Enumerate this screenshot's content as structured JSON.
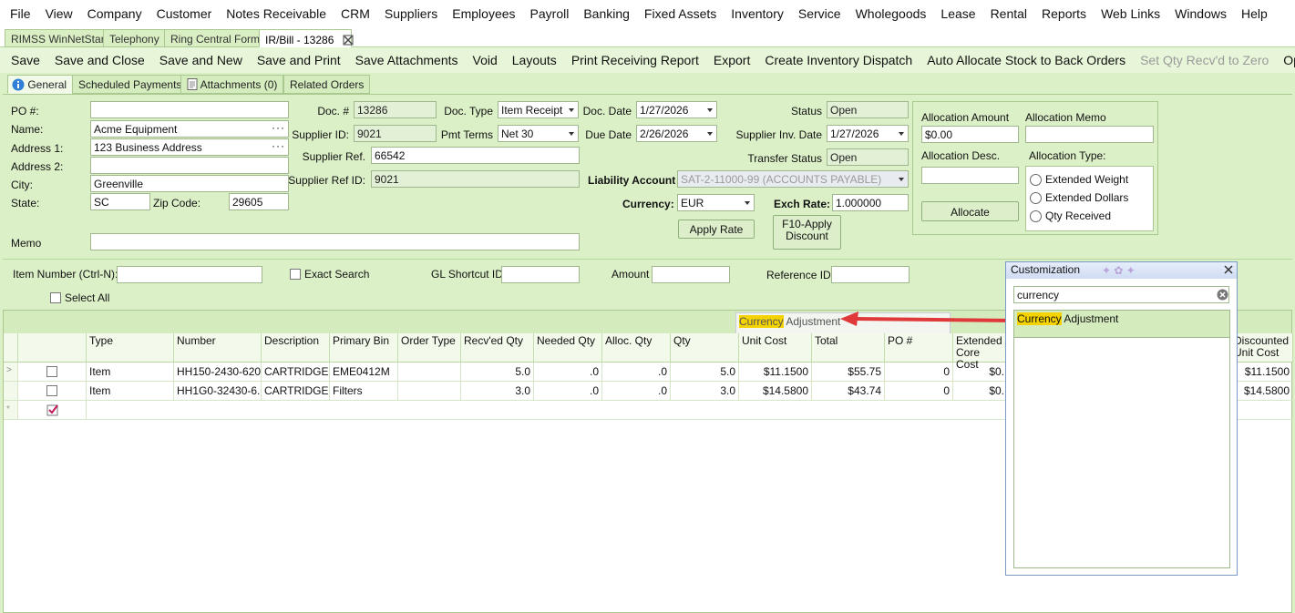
{
  "menu": [
    "File",
    "View",
    "Company",
    "Customer",
    "Notes Receivable",
    "CRM",
    "Suppliers",
    "Employees",
    "Payroll",
    "Banking",
    "Fixed Assets",
    "Inventory",
    "Service",
    "Wholegoods",
    "Lease",
    "Rental",
    "Reports",
    "Web Links",
    "Windows",
    "Help"
  ],
  "window_tabs": [
    "RIMSS WinNetStar",
    "Telephony",
    "Ring Central Form",
    "IR/Bill - 13286"
  ],
  "toolbar": [
    "Save",
    "Save and Close",
    "Save and New",
    "Save and Print",
    "Save Attachments",
    "Void",
    "Layouts",
    "Print Receiving Report",
    "Export",
    "Create Inventory Dispatch",
    "Auto Allocate Stock to Back Orders",
    "Set Qty Recv'd to Zero",
    "Options"
  ],
  "form_tabs": [
    "General",
    "Scheduled Payments",
    "Attachments (0)",
    "Related Orders"
  ],
  "form": {
    "po_label": "PO #:",
    "po": "",
    "name_label": "Name:",
    "name": "Acme Equipment",
    "address1_label": "Address 1:",
    "address1": "123 Business Address",
    "address2_label": "Address 2:",
    "address2": "",
    "city_label": "City:",
    "city": "Greenville",
    "state_label": "State:",
    "state": "SC",
    "zip_label": "Zip Code:",
    "zip": "29605",
    "memo_label": "Memo",
    "memo": "",
    "doc_no_label": "Doc. #",
    "doc_no": "13286",
    "supplier_id_label": "Supplier ID:",
    "supplier_id": "9021",
    "supplier_ref_label": "Supplier Ref.",
    "supplier_ref": "66542",
    "supplier_ref_id_label": "Supplier Ref ID:",
    "supplier_ref_id": "9021",
    "doc_type_label": "Doc. Type",
    "doc_type": "Item Receipt",
    "pmt_terms_label": "Pmt Terms",
    "pmt_terms": "Net 30",
    "doc_date_label": "Doc. Date",
    "doc_date": "1/27/2026",
    "due_date_label": "Due Date",
    "due_date": "2/26/2026",
    "status_label": "Status",
    "status": "Open",
    "supplier_inv_date_label": "Supplier Inv. Date",
    "supplier_inv_date": "1/27/2026",
    "transfer_status_label": "Transfer Status",
    "transfer_status": "Open",
    "liability_account_label": "Liability Account",
    "liability_account": "SAT-2-11000-99 (ACCOUNTS PAYABLE)",
    "currency_label": "Currency:",
    "currency": "EUR",
    "exch_rate_label": "Exch Rate:",
    "exch_rate": "1.000000",
    "apply_rate": "Apply Rate",
    "f10_line1": "F10-Apply",
    "f10_line2": "Discount"
  },
  "allocation": {
    "amount_label": "Allocation Amount",
    "amount": "$0.00",
    "memo_label": "Allocation Memo",
    "memo": "",
    "desc_label": "Allocation Desc.",
    "desc": "",
    "type_label": "Allocation Type:",
    "types": [
      "Extended Weight",
      "Extended Dollars",
      "Qty Received"
    ],
    "allocate": "Allocate"
  },
  "search": {
    "item_number_label": "Item Number (Ctrl-N):",
    "item_number": "",
    "exact_search": "Exact Search",
    "gl_shortcut_label": "GL Shortcut ID",
    "gl_shortcut": "",
    "amount_label": "Amount",
    "amount": "",
    "reference_label": "Reference ID",
    "reference": "",
    "select_all": "Select All"
  },
  "grid": {
    "drag_hint_prefix": "Currency",
    "drag_hint_suffix": " Adjustment",
    "columns": [
      "Type",
      "Number",
      "Description",
      "Primary Bin",
      "Order Type",
      "Recv'ed Qty",
      "Needed Qty",
      "Alloc. Qty",
      "Qty",
      "Unit Cost",
      "Total",
      "PO #",
      "Extended Core Cost",
      "Discounted Unit Cost"
    ],
    "rows": [
      {
        "type": "Item",
        "number": "HH150-2430-620",
        "description": "CARTRIDGE...",
        "bin": "EME0412M",
        "order_type": "",
        "recv": "5.0",
        "needed": ".0",
        "alloc": ".0",
        "qty": "5.0",
        "unit_cost": "$11.1500",
        "total": "$55.75",
        "po": "0",
        "core": "$0.",
        "disc": "$11.1500"
      },
      {
        "type": "Item",
        "number": "HH1G0-32430-6...",
        "description": "CARTRIDGE...",
        "bin": "Filters",
        "order_type": "",
        "recv": "3.0",
        "needed": ".0",
        "alloc": ".0",
        "qty": "3.0",
        "unit_cost": "$14.5800",
        "total": "$43.74",
        "po": "0",
        "core": "$0.",
        "disc": "$14.5800"
      }
    ]
  },
  "customization": {
    "title": "Customization",
    "search": "currency",
    "result_prefix": "Currency",
    "result_suffix": " Adjustment"
  },
  "colors": {
    "bg": "#dcf0c8",
    "highlight": "#f5d300",
    "arrow": "#e0393a"
  }
}
